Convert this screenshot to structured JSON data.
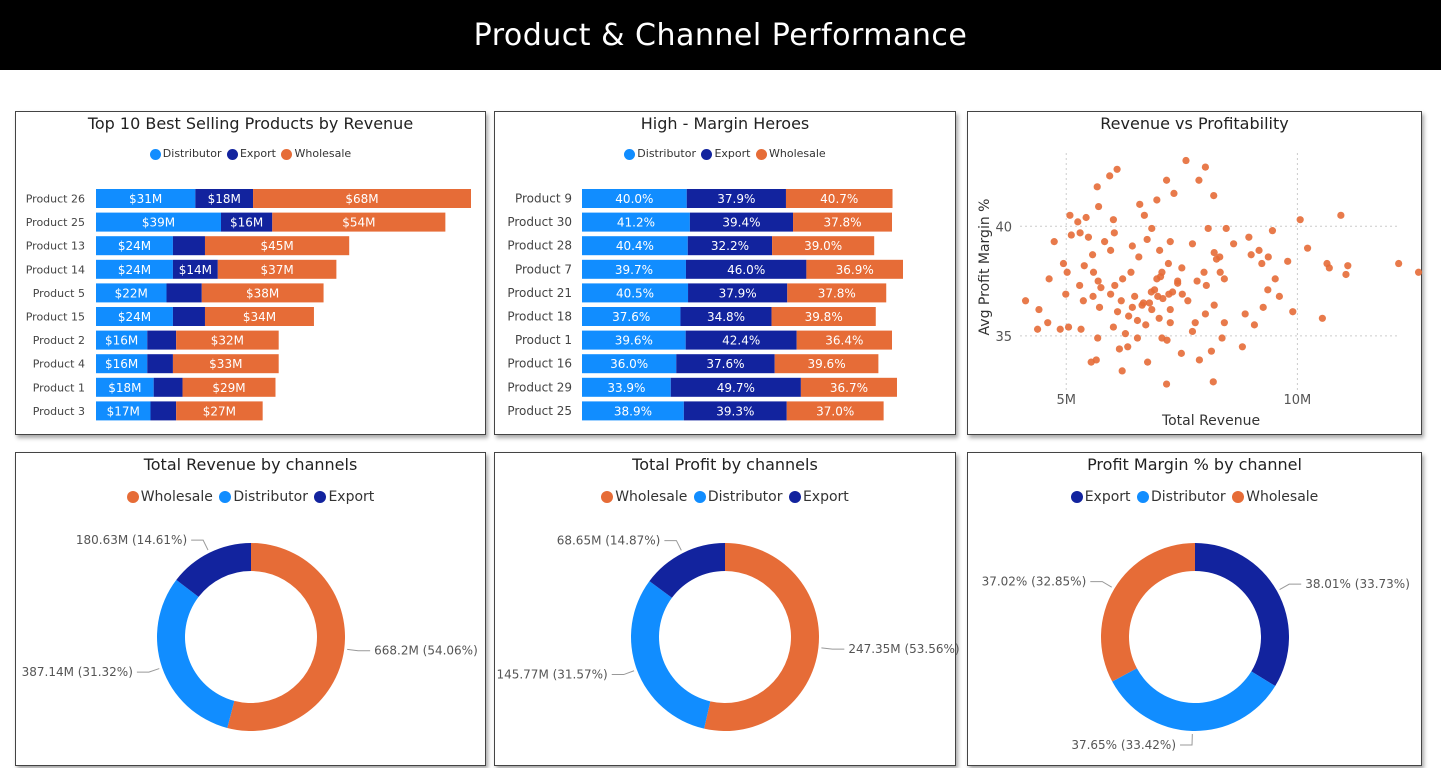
{
  "dashboard": {
    "title": "Product & Channel Performance"
  },
  "colors": {
    "distributor": "#118DFF",
    "export": "#12239E",
    "wholesale": "#E66C37"
  },
  "chart_data": [
    {
      "id": "top10",
      "type": "bar",
      "orientation": "horizontal",
      "stacked": true,
      "title": "Top 10 Best Selling Products by Revenue",
      "legend": [
        "Distributor",
        "Export",
        "Wholesale"
      ],
      "legend_position": "top-center",
      "categories": [
        "Product 26",
        "Product 25",
        "Product 13",
        "Product 14",
        "Product 5",
        "Product 15",
        "Product 2",
        "Product 4",
        "Product 1",
        "Product 3"
      ],
      "series": [
        {
          "name": "Distributor",
          "values": [
            31,
            39,
            24,
            24,
            22,
            24,
            16,
            16,
            18,
            17
          ],
          "labels": [
            "$31M",
            "$39M",
            "$24M",
            "$24M",
            "$22M",
            "$24M",
            "$16M",
            "$16M",
            "$18M",
            "$17M"
          ]
        },
        {
          "name": "Export",
          "values": [
            18,
            16,
            10,
            14,
            11,
            10,
            9,
            8,
            9,
            8
          ],
          "labels": [
            "$18M",
            "$16M",
            "",
            "$14M",
            "",
            "",
            "",
            "",
            "",
            ""
          ]
        },
        {
          "name": "Wholesale",
          "values": [
            68,
            54,
            45,
            37,
            38,
            34,
            32,
            33,
            29,
            27
          ],
          "labels": [
            "$68M",
            "$54M",
            "$45M",
            "$37M",
            "$38M",
            "$34M",
            "$32M",
            "$33M",
            "$29M",
            "$27M"
          ]
        }
      ]
    },
    {
      "id": "heroes",
      "type": "bar",
      "orientation": "horizontal",
      "stacked": true,
      "title": "High - Margin Heroes",
      "legend": [
        "Distributor",
        "Export",
        "Wholesale"
      ],
      "legend_position": "top-center",
      "categories": [
        "Product 9",
        "Product 30",
        "Product 28",
        "Product 7",
        "Product 21",
        "Product 18",
        "Product 1",
        "Product 16",
        "Product 29",
        "Product 25"
      ],
      "series": [
        {
          "name": "Distributor",
          "values": [
            40.0,
            41.2,
            40.4,
            39.7,
            40.5,
            37.6,
            39.6,
            36.0,
            33.9,
            38.9
          ],
          "labels": [
            "40.0%",
            "41.2%",
            "40.4%",
            "39.7%",
            "40.5%",
            "37.6%",
            "39.6%",
            "36.0%",
            "33.9%",
            "38.9%"
          ]
        },
        {
          "name": "Export",
          "values": [
            37.9,
            39.4,
            32.2,
            46.0,
            37.9,
            34.8,
            42.4,
            37.6,
            49.7,
            39.3
          ],
          "labels": [
            "37.9%",
            "39.4%",
            "32.2%",
            "46.0%",
            "37.9%",
            "34.8%",
            "42.4%",
            "37.6%",
            "49.7%",
            "39.3%"
          ]
        },
        {
          "name": "Wholesale",
          "values": [
            40.7,
            37.8,
            39.0,
            36.9,
            37.8,
            39.8,
            36.4,
            39.6,
            36.7,
            37.0
          ],
          "labels": [
            "40.7%",
            "37.8%",
            "39.0%",
            "36.9%",
            "37.8%",
            "39.8%",
            "36.4%",
            "39.6%",
            "36.7%",
            "37.0%"
          ]
        }
      ]
    },
    {
      "id": "scatter",
      "type": "scatter",
      "title": "Revenue vs Profitability",
      "xlabel": "Total Revenue",
      "ylabel": "Avg Profit Margin %",
      "xlim": [
        4000000,
        12500000
      ],
      "ylim": [
        32.3,
        43.8
      ],
      "xticks": [
        5000000,
        10000000
      ],
      "xtick_labels": [
        "5M",
        "10M"
      ],
      "yticks": [
        35,
        40
      ],
      "ytick_labels": [
        "35",
        "40"
      ],
      "grid": true,
      "points": [
        [
          7590000.0,
          43.0
        ],
        [
          8010000.0,
          42.7
        ],
        [
          6100000.0,
          42.6
        ],
        [
          7870000.0,
          42.1
        ],
        [
          5940000.0,
          42.3
        ],
        [
          5670000.0,
          41.8
        ],
        [
          7170000.0,
          42.1
        ],
        [
          8190000.0,
          41.4
        ],
        [
          6960000.0,
          41.2
        ],
        [
          7330000.0,
          41.5
        ],
        [
          6590000.0,
          41.0
        ],
        [
          5700000.0,
          40.9
        ],
        [
          10060000.0,
          40.3
        ],
        [
          10940000.0,
          40.5
        ],
        [
          5080000.0,
          40.5
        ],
        [
          5430000.0,
          40.4
        ],
        [
          5250000.0,
          40.2
        ],
        [
          6020000.0,
          40.3
        ],
        [
          6690000.0,
          40.5
        ],
        [
          4740000.0,
          39.3
        ],
        [
          6850000.0,
          39.9
        ],
        [
          8070000.0,
          39.9
        ],
        [
          8460000.0,
          39.9
        ],
        [
          9460000.0,
          39.8
        ],
        [
          8950000.0,
          39.5
        ],
        [
          6040000.0,
          39.7
        ],
        [
          5110000.0,
          39.6
        ],
        [
          5300000.0,
          39.7
        ],
        [
          5830000.0,
          39.3
        ],
        [
          6750000.0,
          39.4
        ],
        [
          7250000.0,
          39.3
        ],
        [
          8620000.0,
          39.2
        ],
        [
          7730000.0,
          39.2
        ],
        [
          9170000.0,
          38.9
        ],
        [
          10220000.0,
          39.0
        ],
        [
          5960000.0,
          38.9
        ],
        [
          6430000.0,
          39.1
        ],
        [
          7020000.0,
          38.9
        ],
        [
          8200000.0,
          38.8
        ],
        [
          9370000.0,
          38.6
        ],
        [
          5570000.0,
          38.7
        ],
        [
          6570000.0,
          38.6
        ],
        [
          8250000.0,
          38.5
        ],
        [
          9790000.0,
          38.4
        ],
        [
          4940000.0,
          38.3
        ],
        [
          5390000.0,
          38.2
        ],
        [
          7500000.0,
          38.1
        ],
        [
          9230000.0,
          38.3
        ],
        [
          10640000.0,
          38.3
        ],
        [
          11090000.0,
          38.2
        ],
        [
          12190000.0,
          38.3
        ],
        [
          12620000.0,
          37.9
        ],
        [
          10690000.0,
          38.1
        ],
        [
          11050000.0,
          37.8
        ],
        [
          4630000.0,
          37.6
        ],
        [
          5020000.0,
          37.9
        ],
        [
          5590000.0,
          37.9
        ],
        [
          6400000.0,
          37.9
        ],
        [
          7040000.0,
          37.7
        ],
        [
          7980000.0,
          37.9
        ],
        [
          8420000.0,
          37.6
        ],
        [
          9520000.0,
          37.6
        ],
        [
          8330000.0,
          37.9
        ],
        [
          6220000.0,
          37.6
        ],
        [
          6960000.0,
          37.6
        ],
        [
          7830000.0,
          37.5
        ],
        [
          5290000.0,
          37.3
        ],
        [
          5750000.0,
          37.2
        ],
        [
          6910000.0,
          37.1
        ],
        [
          7300000.0,
          37.0
        ],
        [
          8030000.0,
          37.3
        ],
        [
          9360000.0,
          37.1
        ],
        [
          4990000.0,
          36.9
        ],
        [
          5580000.0,
          36.8
        ],
        [
          6480000.0,
          36.8
        ],
        [
          7090000.0,
          36.7
        ],
        [
          7630000.0,
          36.6
        ],
        [
          9610000.0,
          36.8
        ],
        [
          6190000.0,
          36.6
        ],
        [
          6800000.0,
          36.5
        ],
        [
          8200000.0,
          36.4
        ],
        [
          5370000.0,
          36.6
        ],
        [
          5720000.0,
          36.3
        ],
        [
          6850000.0,
          36.2
        ],
        [
          7250000.0,
          36.2
        ],
        [
          9260000.0,
          36.3
        ],
        [
          6110000.0,
          36.1
        ],
        [
          6350000.0,
          35.9
        ],
        [
          7010000.0,
          35.8
        ],
        [
          8870000.0,
          36.0
        ],
        [
          9900000.0,
          36.1
        ],
        [
          8010000.0,
          36.0
        ],
        [
          4410000.0,
          36.2
        ],
        [
          4600000.0,
          35.6
        ],
        [
          5050000.0,
          35.4
        ],
        [
          6020000.0,
          35.4
        ],
        [
          6720000.0,
          35.5
        ],
        [
          7250000.0,
          35.6
        ],
        [
          7790000.0,
          35.6
        ],
        [
          8420000.0,
          35.6
        ],
        [
          9070000.0,
          35.5
        ],
        [
          10540000.0,
          35.8
        ],
        [
          4870000.0,
          35.3
        ],
        [
          5320000.0,
          35.3
        ],
        [
          6280000.0,
          35.1
        ],
        [
          7070000.0,
          34.9
        ],
        [
          7730000.0,
          35.2
        ],
        [
          4380000.0,
          35.3
        ],
        [
          5680000.0,
          34.9
        ],
        [
          6540000.0,
          34.9
        ],
        [
          7180000.0,
          34.8
        ],
        [
          8370000.0,
          34.9
        ],
        [
          8810000.0,
          34.5
        ],
        [
          7490000.0,
          34.2
        ],
        [
          6150000.0,
          34.4
        ],
        [
          5650000.0,
          33.9
        ],
        [
          5540000.0,
          33.8
        ],
        [
          6210000.0,
          33.4
        ],
        [
          6760000.0,
          33.8
        ],
        [
          7880000.0,
          33.9
        ],
        [
          8140000.0,
          34.3
        ],
        [
          8180000.0,
          32.9
        ],
        [
          7170000.0,
          32.8
        ],
        [
          6330000.0,
          34.5
        ],
        [
          6540000.0,
          35.7
        ],
        [
          6670000.0,
          36.5
        ],
        [
          6840000.0,
          37.0
        ],
        [
          7070000.0,
          37.9
        ],
        [
          5960000.0,
          36.9
        ],
        [
          6430000.0,
          36.3
        ],
        [
          7510000.0,
          36.9
        ],
        [
          7410000.0,
          37.4
        ],
        [
          5690000.0,
          37.5
        ],
        [
          7210000.0,
          38.3
        ],
        [
          6640000.0,
          36.4
        ],
        [
          6050000.0,
          37.3
        ],
        [
          8320000.0,
          38.6
        ],
        [
          9000000.0,
          38.7
        ],
        [
          4120000.0,
          36.6
        ],
        [
          5480000.0,
          39.5
        ],
        [
          6980000.0,
          36.8
        ],
        [
          7220000.0,
          36.9
        ],
        [
          7410000.0,
          37.5
        ]
      ]
    },
    {
      "id": "rev_channels",
      "type": "pie",
      "donut": true,
      "title": "Total Revenue by channels",
      "legend": [
        "Wholesale",
        "Distributor",
        "Export"
      ],
      "legend_position": "top-center",
      "slices": [
        {
          "name": "Wholesale",
          "value": 668.2,
          "label": "668.2M (54.06%)"
        },
        {
          "name": "Distributor",
          "value": 387.14,
          "label": "387.14M (31.32%)"
        },
        {
          "name": "Export",
          "value": 180.63,
          "label": "180.63M (14.61%)"
        }
      ]
    },
    {
      "id": "profit_channels",
      "type": "pie",
      "donut": true,
      "title": "Total Profit by channels",
      "legend": [
        "Wholesale",
        "Distributor",
        "Export"
      ],
      "legend_position": "top-center",
      "slices": [
        {
          "name": "Wholesale",
          "value": 247.35,
          "label": "247.35M (53.56%)"
        },
        {
          "name": "Distributor",
          "value": 145.77,
          "label": "145.77M (31.57%)"
        },
        {
          "name": "Export",
          "value": 68.65,
          "label": "68.65M (14.87%)"
        }
      ]
    },
    {
      "id": "margin_channel",
      "type": "pie",
      "donut": true,
      "title": "Profit Margin % by channel",
      "legend": [
        "Export",
        "Distributor",
        "Wholesale"
      ],
      "legend_position": "top-center",
      "slices": [
        {
          "name": "Export",
          "value": 38.01,
          "label": "38.01% (33.73%)"
        },
        {
          "name": "Distributor",
          "value": 37.65,
          "label": "37.65% (33.42%)"
        },
        {
          "name": "Wholesale",
          "value": 37.02,
          "label": "37.02% (32.85%)"
        }
      ]
    }
  ]
}
